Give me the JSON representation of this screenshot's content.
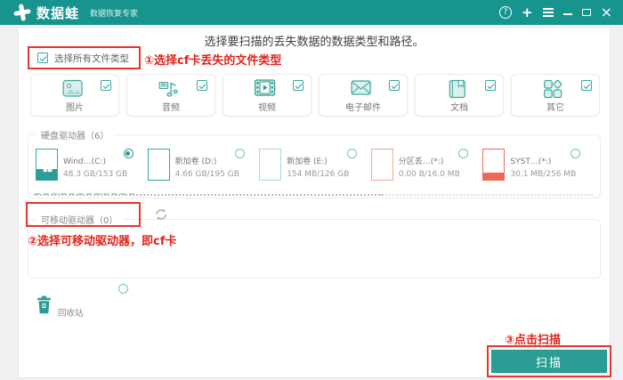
{
  "header": {
    "logo_text": "数据蛙",
    "logo_subtitle": "数据恢复专家",
    "controls": {
      "help": "?",
      "add": "+",
      "close": "×"
    }
  },
  "main": {
    "title": "选择要扫描的丢失数据的数据类型和路径。",
    "select_all": {
      "label": "选择所有文件类型",
      "checked": true
    }
  },
  "annotations": {
    "step1": "①选择cf卡丢失的文件类型",
    "step2": "②选择可移动驱动器，即cf卡",
    "step3": "③点击扫描"
  },
  "file_types": [
    {
      "label": "图片",
      "icon": "image-icon",
      "checked": true
    },
    {
      "label": "音频",
      "icon": "audio-icon",
      "checked": true
    },
    {
      "label": "视频",
      "icon": "video-icon",
      "checked": true
    },
    {
      "label": "电子邮件",
      "icon": "email-icon",
      "checked": true
    },
    {
      "label": "文档",
      "icon": "document-icon",
      "checked": true
    },
    {
      "label": "其它",
      "icon": "other-icon",
      "checked": true
    }
  ],
  "hard_drives": {
    "legend": "硬盘驱动器（6）",
    "items": [
      {
        "name": "Wind…(C:)",
        "capacity": "48.3 GB/153 GB",
        "selected": true
      },
      {
        "name": "新加卷 (D:)",
        "capacity": "4.66 GB/195 GB",
        "selected": false
      },
      {
        "name": "新加卷 (E:)",
        "capacity": "154 MB/126 GB",
        "selected": false
      },
      {
        "name": "分区丢…(*:)",
        "capacity": "0.00 B/16.0 MB",
        "selected": false
      },
      {
        "name": "SYST…(*:)",
        "capacity": "30.1 MB/256 MB",
        "selected": false
      }
    ]
  },
  "removable_drives": {
    "legend": "可移动驱动器（0）",
    "count": 0,
    "refresh_icon": "refresh-icon"
  },
  "recycle_bin": {
    "label": "回收站",
    "selected": false,
    "icon": "trash-icon"
  },
  "scan": {
    "label": "扫描"
  },
  "colors": {
    "accent": "#18948f",
    "annotation_red": "#e2241a",
    "drive_warning": "#f0685a"
  }
}
